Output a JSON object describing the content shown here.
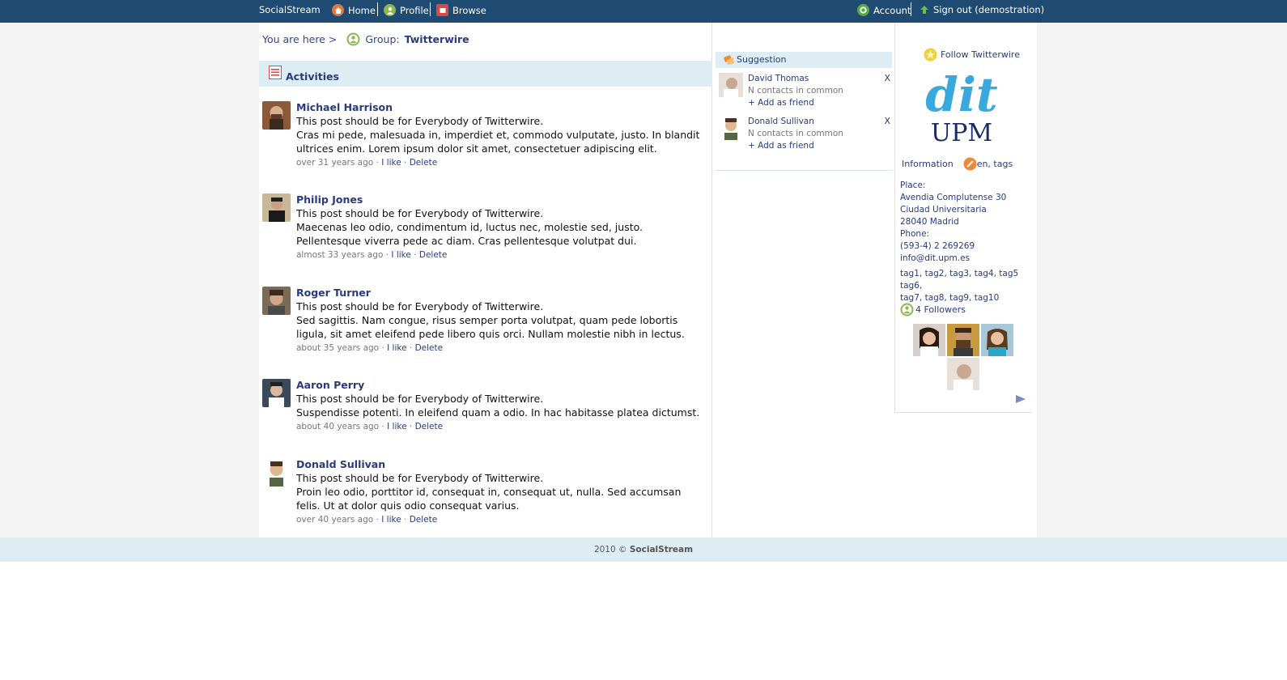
{
  "topbar": {
    "brand": "SocialStream",
    "home": "Home",
    "profile": "Profile",
    "browse": "Browse",
    "account": "Account",
    "signout": "Sign out (demostration)"
  },
  "breadcrumb": {
    "prefix": "You are here >",
    "group_label": "Group:",
    "group_name": "Twitterwire"
  },
  "activities": {
    "title": "Activities",
    "items": [
      {
        "author": "Michael Harrison",
        "line1": "This post should be for Everybody of Twitterwire.",
        "line2": "Cras mi pede, malesuada in, imperdiet et, commodo vulputate, justo. In blandit ultrices enim. Lorem ipsum dolor sit amet, consectetuer adipiscing elit.",
        "time": "over 31 years ago",
        "like": "I like",
        "delete": "Delete"
      },
      {
        "author": "Philip Jones",
        "line1": "This post should be for Everybody of Twitterwire.",
        "line2": "Maecenas leo odio, condimentum id, luctus nec, molestie sed, justo. Pellentesque viverra pede ac diam. Cras pellentesque volutpat dui.",
        "time": "almost 33 years ago",
        "like": "I like",
        "delete": "Delete"
      },
      {
        "author": "Roger Turner",
        "line1": "This post should be for Everybody of Twitterwire.",
        "line2": "Sed sagittis. Nam congue, risus semper porta volutpat, quam pede lobortis ligula, sit amet eleifend pede libero quis orci. Nullam molestie nibh in lectus.",
        "time": "about 35 years ago",
        "like": "I like",
        "delete": "Delete"
      },
      {
        "author": "Aaron Perry",
        "line1": "This post should be for Everybody of Twitterwire.",
        "line2": "Suspendisse potenti. In eleifend quam a odio. In hac habitasse platea dictumst.",
        "time": "about 40 years ago",
        "like": "I like",
        "delete": "Delete"
      },
      {
        "author": "Donald Sullivan",
        "line1": "This post should be for Everybody of Twitterwire.",
        "line2": "Proin leo odio, porttitor id, consequat in, consequat ut, nulla. Sed accumsan felis. Ut at dolor quis odio consequat varius.",
        "time": "over 40 years ago",
        "like": "I like",
        "delete": "Delete"
      }
    ]
  },
  "suggestion": {
    "title": "Suggestion",
    "items": [
      {
        "name": "David Thomas",
        "common": "N contacts in common",
        "add": "+ Add as friend",
        "close": "X"
      },
      {
        "name": "Donald Sullivan",
        "common": "N contacts in common",
        "add": "+ Add as friend",
        "close": "X"
      }
    ]
  },
  "group_info": {
    "follow": "Follow Twitterwire",
    "logo_top": "dit",
    "logo_bottom": "UPM",
    "information": "Information",
    "lang_tags": "en, tags",
    "place_label": "Place:",
    "address1": "Avendia Complutense 30",
    "address2": "Ciudad Universitaria",
    "address3": "28040 Madrid",
    "phone_label": "Phone:",
    "phone": "(593-4) 2 269269",
    "email": "info@dit.upm.es",
    "tags_line1": "tag1, tag2, tag3, tag4, tag5 tag6,",
    "tags_line2": "tag7, tag8, tag9, tag10",
    "followers": "4 Followers"
  },
  "footer": {
    "year": "2010 ©",
    "brand": "SocialStream"
  },
  "colors": {
    "topbar": "#1f4a72",
    "accent_blue": "#2a3a7e",
    "light_blue": "#deecf4"
  }
}
